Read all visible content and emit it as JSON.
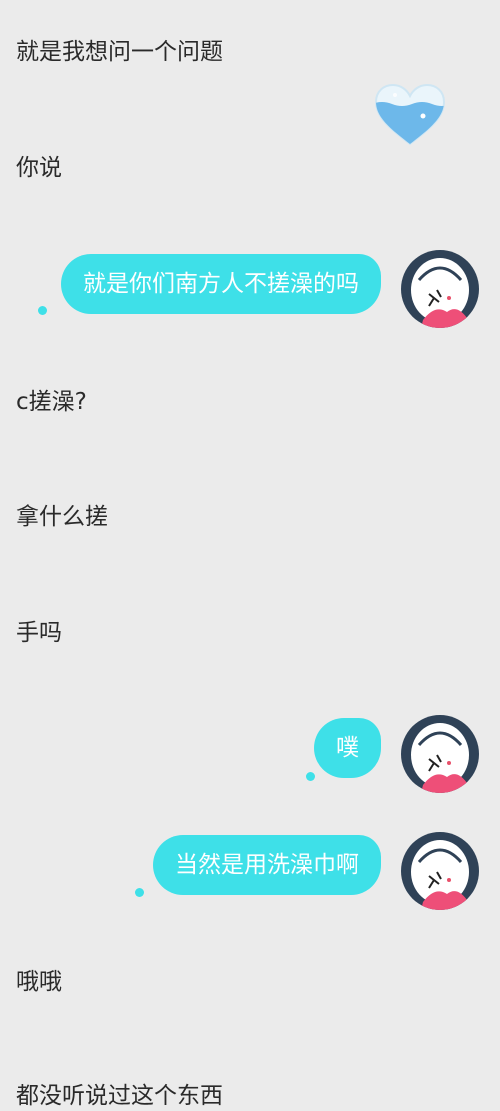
{
  "messages": {
    "m1": "就是我想问一个问题",
    "m2": "你说",
    "m3": "就是你们南方人不搓澡的吗",
    "m4": "c搓澡?",
    "m5": "拿什么搓",
    "m6": "手吗",
    "m7": "噗",
    "m8": "当然是用洗澡巾啊",
    "m9": "哦哦",
    "m10": "都没听说过这个东西"
  },
  "colors": {
    "bubble": "#3ee0e8",
    "background": "#ebebeb",
    "text": "#2a2a2a"
  },
  "icons": {
    "heart": "blue-heart-icon",
    "avatar": "user-avatar"
  }
}
